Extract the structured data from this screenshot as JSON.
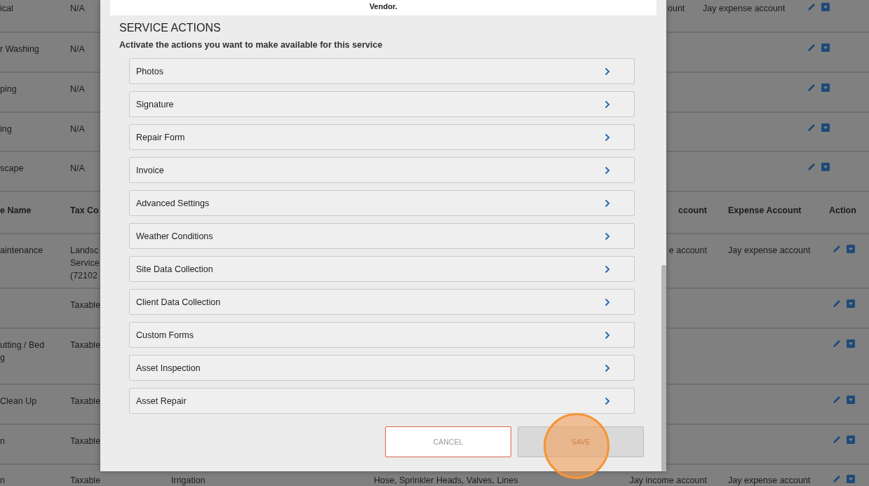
{
  "upper_table": {
    "rows": [
      {
        "name": "ical",
        "tax_code": "N/A",
        "income_account": "ount",
        "expense_account": "Jay expense account"
      },
      {
        "name": "r Washing",
        "tax_code": "N/A"
      },
      {
        "name": "ping",
        "tax_code": "N/A"
      },
      {
        "name": "ing",
        "tax_code": "N/A"
      },
      {
        "name": "scape",
        "tax_code": "N/A"
      }
    ]
  },
  "lower_table": {
    "columns": {
      "name": "e Name",
      "tax_code": "Tax Co",
      "income_account": "ccount",
      "expense_account": "Expense Account",
      "action": "Action"
    },
    "rows": [
      {
        "name": "aintenance",
        "tax_code": "Landsc\nService\n(72102",
        "income_account": "e account",
        "expense_account": "Jay expense account"
      },
      {
        "tax_code": "Taxable"
      },
      {
        "name": "utting / Bed\ng",
        "tax_code": "Taxable"
      },
      {
        "name": "Clean Up",
        "tax_code": "Taxable"
      },
      {
        "name": "n",
        "tax_code": "Taxable"
      },
      {
        "name": "n",
        "tax_code": "Taxable",
        "category": "Irrigation",
        "items": "Hose, Sprinkler Heads, Valves, Lines",
        "income_account": "Jay income account",
        "expense_account": "Jay expense account"
      }
    ]
  },
  "modal": {
    "top_text": "Vendor.",
    "section_title": "SERVICE ACTIONS",
    "section_hint": "Activate the actions you want to make available for this service",
    "actions": [
      "Photos",
      "Signature",
      "Repair Form",
      "Invoice",
      "Advanced Settings",
      "Weather Conditions",
      "Site Data Collection",
      "Client Data Collection",
      "Custom Forms",
      "Asset Inspection",
      "Asset Repair"
    ],
    "buttons": [
      {
        "kind": "cancel",
        "label": "CANCEL"
      },
      {
        "kind": "save",
        "label": "SAVE"
      }
    ]
  }
}
